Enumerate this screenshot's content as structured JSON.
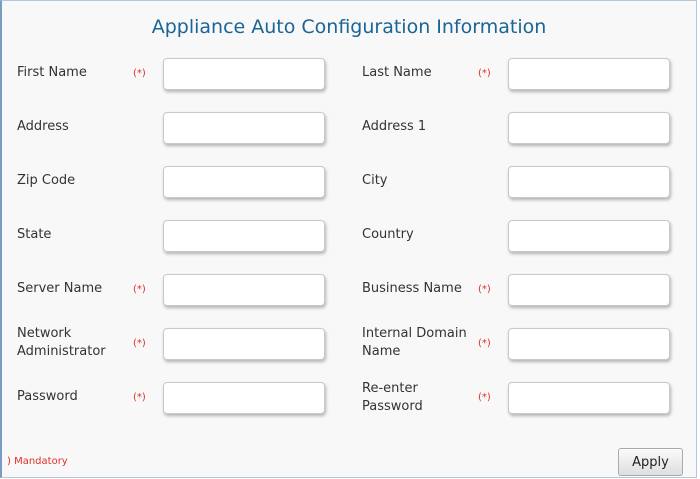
{
  "form": {
    "title": "Appliance Auto Configuration Information",
    "required_marker": "(*)",
    "mandatory_note": ") Mandatory",
    "apply_label": "Apply",
    "fields": {
      "first_name": {
        "label": "First Name",
        "value": "",
        "required": true
      },
      "last_name": {
        "label": "Last Name",
        "value": "",
        "required": true
      },
      "address": {
        "label": "Address",
        "value": "",
        "required": false
      },
      "address_1": {
        "label": "Address 1",
        "value": "",
        "required": false
      },
      "zip_code": {
        "label": "Zip Code",
        "value": "",
        "required": false
      },
      "city": {
        "label": "City",
        "value": "",
        "required": false
      },
      "state": {
        "label": "State",
        "value": "",
        "required": false
      },
      "country": {
        "label": "Country",
        "value": "",
        "required": false
      },
      "server_name": {
        "label": "Server Name",
        "value": "",
        "required": true
      },
      "business_name": {
        "label": "Business Name",
        "value": "",
        "required": true
      },
      "network_administrator": {
        "label_line1": "Network",
        "label_line2": "Administrator",
        "value": "",
        "required": true
      },
      "internal_domain_name": {
        "label_line1": "Internal Domain",
        "label_line2": "Name",
        "value": "",
        "required": true
      },
      "password": {
        "label": "Password",
        "value": "",
        "required": true
      },
      "reenter_password": {
        "label_line1": "Re-enter",
        "label_line2": "Password",
        "value": "",
        "required": true
      }
    }
  }
}
